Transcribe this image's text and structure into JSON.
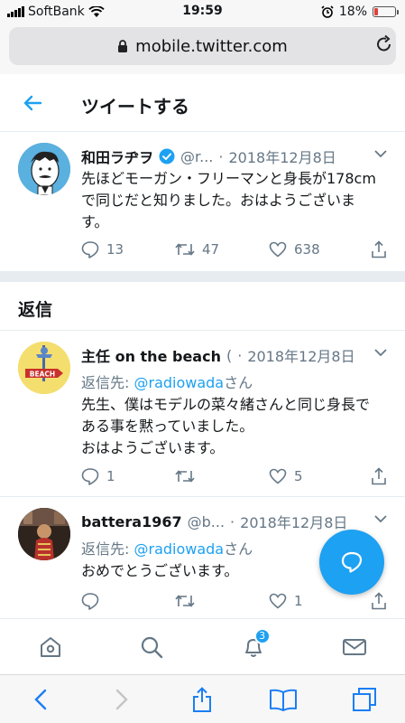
{
  "status_bar": {
    "carrier": "SoftBank",
    "time": "19:59",
    "battery_percent": "18%",
    "battery_level": 0.18
  },
  "browser": {
    "url": "mobile.twitter.com"
  },
  "header": {
    "title": "ツイートする"
  },
  "main_tweet": {
    "name": "和田ラヂヲ",
    "handle": "@r...",
    "dot": "·",
    "date": "2018年12月8日",
    "text_line1": "先ほどモーガン・フリーマンと身長が178cm",
    "text_line2": "で同じだと知りました。おはようございま",
    "text_line3": "す。",
    "replies": "13",
    "retweets": "47",
    "likes": "638"
  },
  "replies_header": "返信",
  "replies": [
    {
      "name": "主任 on the beach",
      "handle": "(",
      "dot": "·",
      "date": "2018年12月8日",
      "reply_to_label": "返信先: ",
      "reply_to_user": "@radiowada",
      "reply_to_suffix": "さん",
      "text_line1": "先生、僕はモデルの菜々緒さんと同じ身長で",
      "text_line2": "ある事を黙っていました。",
      "text_line3": "おはようございます。",
      "replies": "1",
      "retweets": "",
      "likes": "5",
      "avatar_text": "BEACH"
    },
    {
      "name": "battera1967",
      "handle": "@b...",
      "dot": "·",
      "date": "2018年12月8日",
      "reply_to_label": "返信先: ",
      "reply_to_user": "@radiowada",
      "reply_to_suffix": "さん",
      "text_line1": "おめでとうございます。",
      "replies": "",
      "retweets": "",
      "likes": "1"
    }
  ],
  "notifications_badge": "3",
  "colors": {
    "accent": "#1da1f2",
    "secondary_text": "#657786",
    "divider": "#e6ecf0"
  }
}
